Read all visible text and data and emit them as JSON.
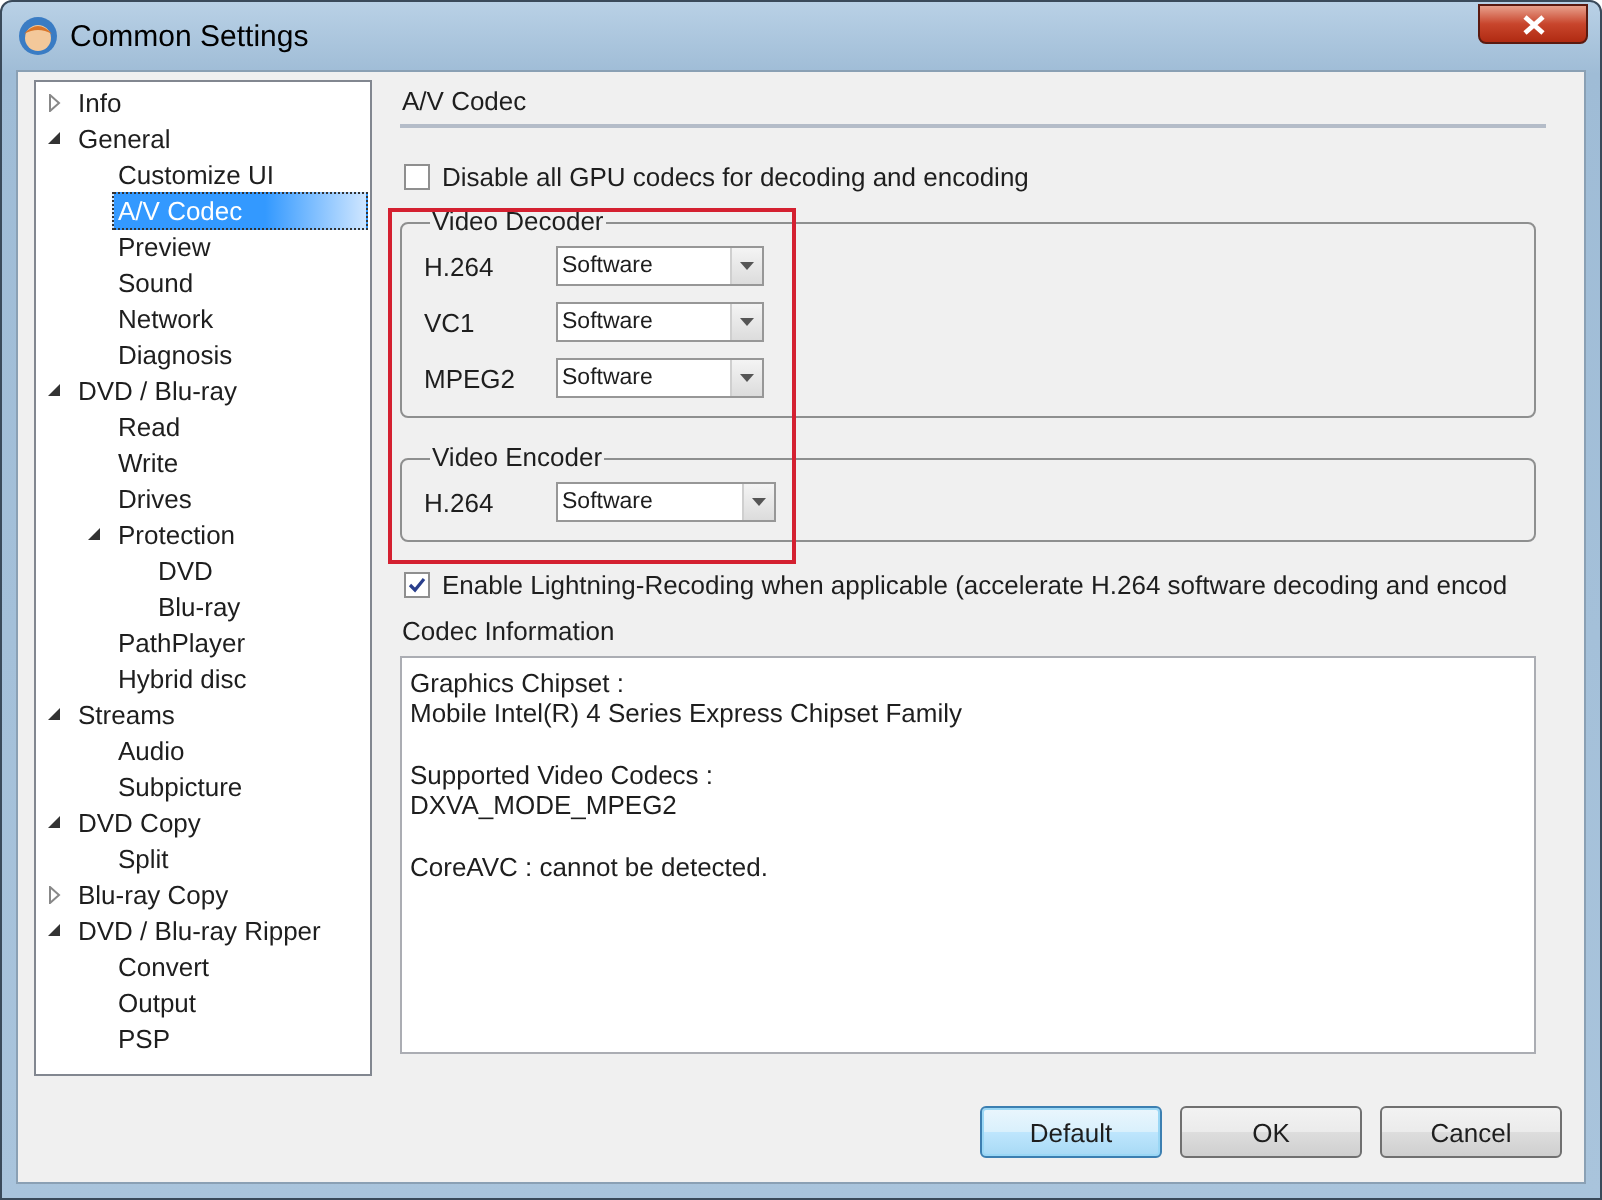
{
  "window": {
    "title": "Common Settings"
  },
  "tree": [
    {
      "label": "Info",
      "expanded": false,
      "selected": false
    },
    {
      "label": "General",
      "expanded": true,
      "selected": false,
      "children": [
        {
          "label": "Customize UI",
          "selected": false
        },
        {
          "label": "A/V Codec",
          "selected": true
        },
        {
          "label": "Preview",
          "selected": false
        },
        {
          "label": "Sound",
          "selected": false
        },
        {
          "label": "Network",
          "selected": false
        },
        {
          "label": "Diagnosis",
          "selected": false
        }
      ]
    },
    {
      "label": "DVD / Blu-ray",
      "expanded": true,
      "selected": false,
      "children": [
        {
          "label": "Read",
          "selected": false
        },
        {
          "label": "Write",
          "selected": false
        },
        {
          "label": "Drives",
          "selected": false
        },
        {
          "label": "Protection",
          "expanded": true,
          "selected": false,
          "children": [
            {
              "label": "DVD",
              "selected": false
            },
            {
              "label": "Blu-ray",
              "selected": false
            }
          ]
        },
        {
          "label": "PathPlayer",
          "selected": false
        },
        {
          "label": "Hybrid disc",
          "selected": false
        }
      ]
    },
    {
      "label": "Streams",
      "expanded": true,
      "selected": false,
      "children": [
        {
          "label": "Audio",
          "selected": false
        },
        {
          "label": "Subpicture",
          "selected": false
        }
      ]
    },
    {
      "label": "DVD Copy",
      "expanded": true,
      "selected": false,
      "children": [
        {
          "label": "Split",
          "selected": false
        }
      ]
    },
    {
      "label": "Blu-ray Copy",
      "expanded": false,
      "selected": false
    },
    {
      "label": "DVD / Blu-ray Ripper",
      "expanded": true,
      "selected": false,
      "children": [
        {
          "label": "Convert",
          "selected": false
        },
        {
          "label": "Output",
          "selected": false
        },
        {
          "label": "PSP",
          "selected": false
        }
      ]
    }
  ],
  "section_title": "A/V Codec",
  "disable_gpu": {
    "label": "Disable all GPU codecs for decoding and encoding",
    "checked": false
  },
  "groups": [
    {
      "title": "Video Decoder",
      "rows": [
        {
          "label": "H.264",
          "value": "Software"
        },
        {
          "label": "VC1",
          "value": "Software"
        },
        {
          "label": "MPEG2",
          "value": "Software"
        }
      ]
    },
    {
      "title": "Video Encoder",
      "rows": [
        {
          "label": "H.264",
          "value": "Software"
        }
      ]
    }
  ],
  "lightning": {
    "label": "Enable Lightning-Recoding when applicable (accelerate H.264 software decoding and encod",
    "checked": true
  },
  "codec_info": {
    "label": "Codec Information",
    "paragraphs": [
      {
        "lines": [
          "Graphics Chipset :",
          "Mobile Intel(R) 4 Series Express Chipset Family"
        ]
      },
      {
        "lines": [
          "Supported Video Codecs :",
          "DXVA_MODE_MPEG2"
        ]
      },
      {
        "lines": [
          "CoreAVC : cannot be detected."
        ]
      }
    ]
  },
  "buttons": [
    {
      "label": "Default",
      "focused": true
    },
    {
      "label": "OK",
      "focused": false
    },
    {
      "label": "Cancel",
      "focused": false
    }
  ]
}
